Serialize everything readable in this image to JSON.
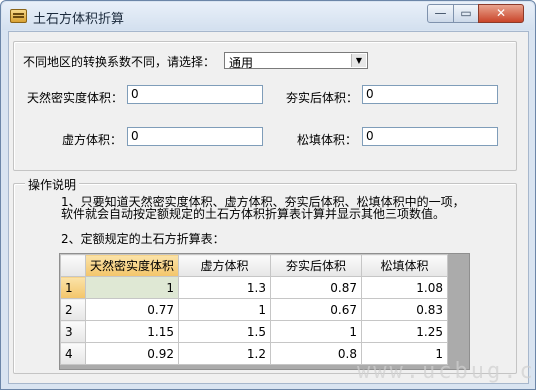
{
  "window": {
    "title": "土石方体积折算",
    "buttons": {
      "minimize": "—",
      "maximize": "▭",
      "close": "✕"
    }
  },
  "form": {
    "region_label": "不同地区的转换系数不同，请选择：",
    "region_selected": "通用",
    "natural_label": "天然密实度体积：",
    "natural_value": "0",
    "compacted_label": "夯实后体积：",
    "compacted_value": "0",
    "loose_label": "虚方体积：",
    "loose_value": "0",
    "fill_label": "松填体积：",
    "fill_value": "0"
  },
  "instructions": {
    "group_title": "操作说明",
    "line1": "1、只要知道天然密实度体积、虚方体积、夯实后体积、松填体积中的一项，",
    "line2": "软件就会自动按定额规定的土石方体积折算表计算并显示其他三项数值。",
    "line3": "2、定额规定的土石方折算表："
  },
  "table": {
    "headers": [
      "天然密实度体积",
      "虚方体积",
      "夯实后体积",
      "松填体积"
    ],
    "rows": [
      {
        "num": "1",
        "cells": [
          "1",
          "1.3",
          "0.87",
          "1.08"
        ]
      },
      {
        "num": "2",
        "cells": [
          "0.77",
          "1",
          "0.67",
          "0.83"
        ]
      },
      {
        "num": "3",
        "cells": [
          "1.15",
          "1.5",
          "1",
          "1.25"
        ]
      },
      {
        "num": "4",
        "cells": [
          "0.92",
          "1.2",
          "0.8",
          "1"
        ]
      }
    ]
  },
  "watermark": "www.ucbug.cc"
}
